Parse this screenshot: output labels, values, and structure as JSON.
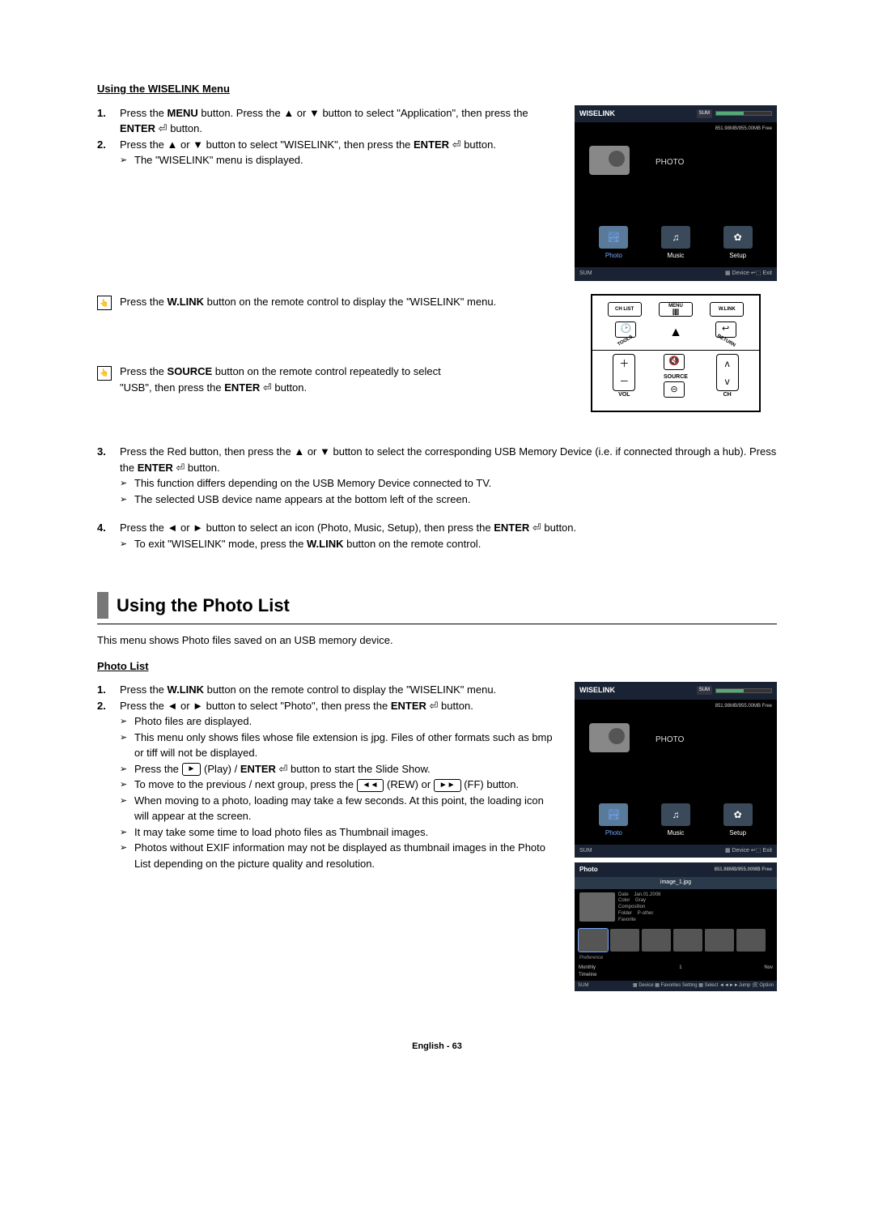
{
  "section1": {
    "title": "Using the WISELINK Menu",
    "item1": {
      "num": "1.",
      "pre": "Press the ",
      "b1": "MENU",
      "mid1": " button. Press the ▲ or ▼ button to select \"Application\", then press the ",
      "b2": "ENTER",
      "glyph": " ⏎",
      "post": " button."
    },
    "item2": {
      "num": "2.",
      "pre": "Press the ▲ or ▼ button to select \"WISELINK\", then press the ",
      "b1": "ENTER",
      "glyph": " ⏎",
      "post": " button.",
      "sub1": "The \"WISELINK\" menu is displayed."
    },
    "note1": {
      "icon": "👆",
      "pre": "Press the ",
      "b1": "W.LINK",
      "post": " button on the remote control to display the \"WISELINK\" menu."
    },
    "note2": {
      "icon": "👆",
      "pre": "Press the ",
      "b1": "SOURCE",
      "mid": " button on the remote control repeatedly to select \"USB\", then press the ",
      "b2": "ENTER",
      "glyph": " ⏎",
      "post": " button."
    },
    "item3": {
      "num": "3.",
      "pre": "Press the Red button, then press the ▲ or ▼ button to select the corresponding USB Memory Device (i.e. if connected through a hub). Press the ",
      "b1": "ENTER",
      "glyph": " ⏎",
      "post": " button.",
      "sub1": "This function differs depending on the USB Memory Device connected to TV.",
      "sub2": "The selected USB device name appears at the bottom left of the screen."
    },
    "item4": {
      "num": "4.",
      "pre": "Press the ◄ or ► button to select an icon (Photo, Music, Setup), then press the ",
      "b1": "ENTER",
      "glyph": " ⏎",
      "post": " button.",
      "sub1pre": "To exit \"WISELINK\" mode, press the ",
      "sub1b": "W.LINK",
      "sub1post": " button on the remote control."
    }
  },
  "wiselink": {
    "title": "WISELINK",
    "mem": "851.98MB/955.00MB Free",
    "photo_big": "PHOTO",
    "icons": {
      "photo": "Photo",
      "music": "Music",
      "setup": "Setup"
    },
    "footer_l": "SUM",
    "footer_r": "▦ Device   ↩⬚ Exit",
    "music_glyph": "♫",
    "setup_glyph": "✿",
    "photo_glyph": "🏞"
  },
  "remote": {
    "chlist": "CH LIST",
    "menu": "MENU",
    "wlink": "W.LINK",
    "tools": "TOOLS",
    "return": "RETURN",
    "vol": "VOL",
    "source": "SOURCE",
    "ch": "CH",
    "mute_glyph": "🔇",
    "src_glyph": "⊝",
    "tools_glyph": "🕑",
    "return_glyph": "↩",
    "list_glyph": "⫿⫿⫿"
  },
  "section2": {
    "heading": "Using the Photo List",
    "intro": "This menu shows Photo files saved on an USB memory device.",
    "title": "Photo List",
    "item1": {
      "num": "1.",
      "pre": "Press the ",
      "b1": "W.LINK",
      "post": " button on the remote control to display the \"WISELINK\" menu."
    },
    "item2": {
      "num": "2.",
      "pre": "Press the ◄ or ► button to select \"Photo\", then press the ",
      "b1": "ENTER",
      "glyph": " ⏎",
      "post": " button.",
      "sub1": "Photo files are displayed.",
      "sub2": "This menu only shows files whose file extension is jpg. Files of other formats such as bmp or tiff will not be displayed.",
      "sub3pre": "Press the ",
      "sub3btn": "►",
      "sub3mid": " (Play) / ",
      "sub3b": "ENTER",
      "sub3glyph": " ⏎",
      "sub3post": " button to start the Slide Show.",
      "sub4pre": "To move to the previous / next group, press the ",
      "sub4btn1": "◄◄",
      "sub4mid": " (REW) or ",
      "sub4btn2": "►►",
      "sub4post": " (FF) button.",
      "sub5": "When moving to a photo, loading may take a few seconds. At this point, the loading icon will appear at the screen.",
      "sub6": "It may take some time to load photo files as Thumbnail images.",
      "sub7": "Photos without EXIF information may not be displayed as thumbnail images in the Photo List depending on the picture quality and resolution."
    }
  },
  "photoscreen": {
    "title": "Photo",
    "file": "image_1.jpg",
    "date_k": "Date",
    "date_v": "Jan.01.2008",
    "color_k": "Color",
    "color_v": "Gray",
    "comp_k": "Composition",
    "comp_v": "",
    "folder_k": "Folder",
    "folder_v": "P-other",
    "fav_k": "Favorite",
    "tag_pref": "Preference",
    "tag_month": "Monthly",
    "tag_time": "Timeline",
    "pos": "1",
    "pos_r": "Nov",
    "footer_l": "SUM",
    "footer_r": "▦ Device  ▦ Favorites Setting  ▦ Select  ◄◄►►Jump  🛠 Option"
  },
  "page": {
    "lang": "English - ",
    "num": "63"
  }
}
